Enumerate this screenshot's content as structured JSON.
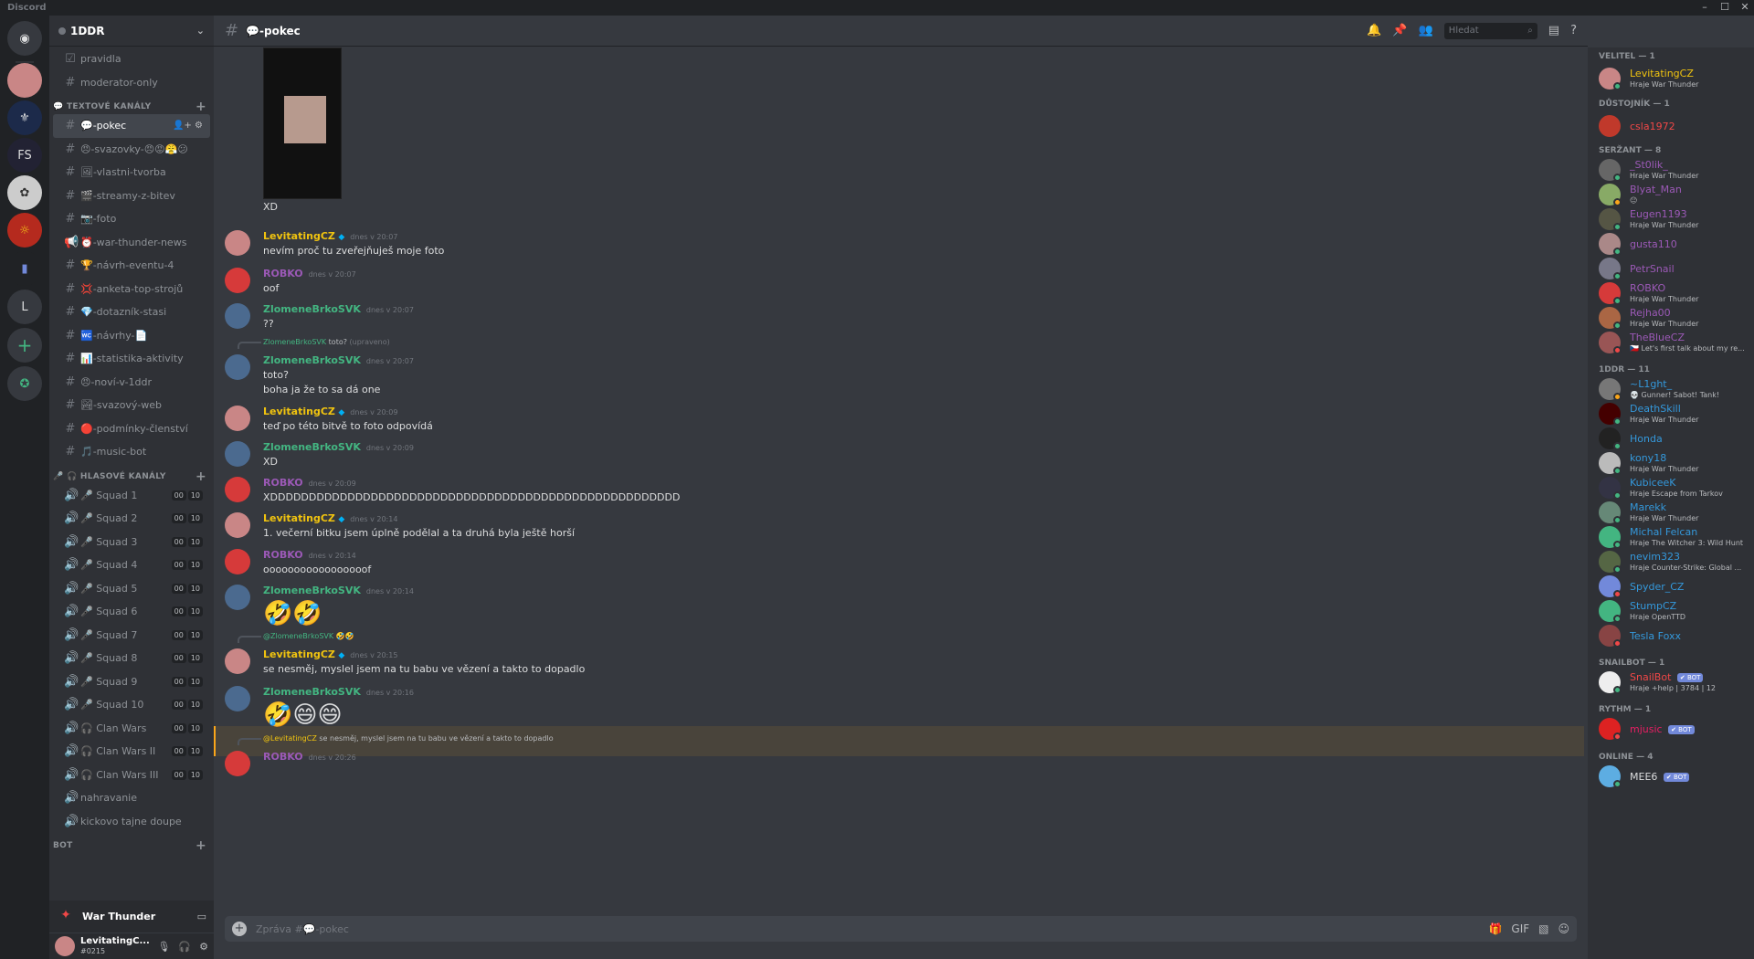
{
  "window": {
    "app_name": "Discord"
  },
  "guild": {
    "name": "1DDR"
  },
  "channels": {
    "top": [
      {
        "icon": "☑",
        "label": "pravidla"
      },
      {
        "icon": "#",
        "label": "moderator-only"
      }
    ],
    "text_category": "💬 TEXTOVÉ KANÁLY",
    "text": [
      "💬-pokec",
      "😠-svazovky-😠😡😤😕",
      "🖼-vlastni-tvorba",
      "🎬-streamy-z-bitev",
      "📷-foto",
      "⏰-war-thunder-news",
      "🏆-návrh-eventu-4",
      "💢-anketa-top-strojů",
      "💎-dotazník-stasi",
      "🚾-návrhy-📄",
      "📊-statistika-aktivity",
      "😠-noví-v-1ddr",
      "🏞-svazový-web",
      "🔴-podmínky-členství",
      "🎵-music-bot"
    ],
    "voice_category": "🎤 🎧 HLASOVÉ KANÁLY",
    "voice": [
      "🎤 Squad 1",
      "🎤 Squad 2",
      "🎤 Squad 3",
      "🎤 Squad 4",
      "🎤 Squad 5",
      "🎤 Squad 6",
      "🎤 Squad 7",
      "🎤 Squad 8",
      "🎤 Squad 9",
      "🎤 Squad 10",
      "🎧 Clan Wars",
      "🎧 Clan Wars II",
      "🎧 Clan Wars III"
    ],
    "extra": [
      "nahravanie",
      "kickovo tajne doupe"
    ],
    "count_left": "00",
    "count_right": "10",
    "bot_category": "BOT"
  },
  "voice_panel": {
    "label": "War Thunder"
  },
  "user_panel": {
    "name": "LevitatingC...",
    "discriminator": "#0215"
  },
  "topbar": {
    "channel": "💬-pokec",
    "search_placeholder": "Hledat"
  },
  "messages": [
    {
      "name": "",
      "time": "",
      "lines": [
        "XD"
      ]
    },
    {
      "name": "LevitatingCZ",
      "time": "dnes v 20:07",
      "lines": [
        "nevím proč tu zveřejňuješ moje foto"
      ]
    },
    {
      "name": "ROBKO",
      "time": "dnes v 20:07",
      "lines": [
        "oof"
      ]
    },
    {
      "name": "ZlomeneBrkoSVK",
      "time": "dnes v 20:07",
      "lines": [
        "??"
      ]
    },
    {
      "reply_name": "ZlomeneBrkoSVK",
      "reply_text": "toto?",
      "reply_tag": "(upraveno)",
      "name": "ZlomeneBrkoSVK",
      "time": "dnes v 20:07",
      "lines": [
        "toto?",
        "boha ja že to sa dá one"
      ]
    },
    {
      "name": "LevitatingCZ",
      "time": "dnes v 20:09",
      "lines": [
        "teď po této bitvě to foto odpovídá"
      ]
    },
    {
      "name": "ZlomeneBrkoSVK",
      "time": "dnes v 20:09",
      "lines": [
        "XD"
      ]
    },
    {
      "name": "ROBKO",
      "time": "dnes v 20:09",
      "lines": [
        "XDDDDDDDDDDDDDDDDDDDDDDDDDDDDDDDDDDDDDDDDDDDDDDDDDDDDD"
      ]
    },
    {
      "name": "LevitatingCZ",
      "time": "dnes v 20:14",
      "lines": [
        "1. večerní bitku jsem úplně podělal a ta druhá byla ještě horší"
      ]
    },
    {
      "name": "ROBKO",
      "time": "dnes v 20:14",
      "lines": [
        "ooooooooooooooooof"
      ]
    },
    {
      "name": "ZlomeneBrkoSVK",
      "time": "dnes v 20:14",
      "lines": [
        "🤣🤣"
      ]
    },
    {
      "reply_name": "@ZlomeneBrkoSVK",
      "reply_text": "🤣🤣",
      "name": "LevitatingCZ",
      "time": "dnes v 20:15",
      "lines": [
        "se nesměj, myslel jsem na tu babu ve vězení a takto to dopadlo"
      ]
    },
    {
      "name": "ZlomeneBrkoSVK",
      "time": "dnes v 20:16",
      "lines": [
        "🤣😄😄"
      ]
    },
    {
      "reply_name": "@LevitatingCZ",
      "reply_text": "se nesměj, myslel jsem na tu babu ve vězení a takto to dopadlo",
      "name": "ROBKO",
      "time": "dnes v 20:26",
      "lines": []
    }
  ],
  "composer": {
    "placeholder": "Zpráva #💬-pokec"
  },
  "members": {
    "categories": [
      "VELITEL — 1",
      "DŮSTOJNÍK — 1",
      "SERŽANT — 8",
      "1DDR — 11",
      "SNAILBOT — 1",
      "RYTHM — 1",
      "ONLINE — 4"
    ],
    "list": [
      {
        "name": "LevitatingCZ",
        "activity": "Hraje War Thunder"
      },
      {
        "name": "csla1972",
        "activity": ""
      },
      {
        "name": "_St0lik_",
        "activity": "Hraje War Thunder"
      },
      {
        "name": "Blyat_Man",
        "activity": "😐"
      },
      {
        "name": "Eugen1193",
        "activity": "Hraje War Thunder"
      },
      {
        "name": "gusta110",
        "activity": ""
      },
      {
        "name": "PetrSnail",
        "activity": ""
      },
      {
        "name": "ROBKO",
        "activity": "Hraje War Thunder"
      },
      {
        "name": "Rejha00",
        "activity": "Hraje War Thunder"
      },
      {
        "name": "TheBlueCZ",
        "activity": "🇨🇿 Let's first talk about my re..."
      },
      {
        "name": "~L1ght_",
        "activity": "💀 Gunner! Sabot! Tank!"
      },
      {
        "name": "DeathSkill",
        "activity": "Hraje War Thunder"
      },
      {
        "name": "Honda",
        "activity": ""
      },
      {
        "name": "kony18",
        "activity": "Hraje War Thunder"
      },
      {
        "name": "KubiceeK",
        "activity": "Hraje Escape from Tarkov"
      },
      {
        "name": "Marekk",
        "activity": "Hraje War Thunder"
      },
      {
        "name": "Michal Felcan",
        "activity": "Hraje The Witcher 3: Wild Hunt"
      },
      {
        "name": "nevim323",
        "activity": "Hraje Counter-Strike: Global ..."
      },
      {
        "name": "Spyder_CZ",
        "activity": ""
      },
      {
        "name": "StumpCZ",
        "activity": "Hraje OpenTTD"
      },
      {
        "name": "Tesla Foxx",
        "activity": ""
      },
      {
        "name": "SnailBot",
        "activity": "Hraje +help | 3784 | 12"
      },
      {
        "name": "mjusic",
        "activity": ""
      },
      {
        "name": "MEE6",
        "activity": ""
      }
    ],
    "bot_label": "✔ BOT"
  },
  "colors": {
    "accent": "#7289da",
    "online": "#43b581",
    "dnd": "#f04747",
    "idle": "#faa61a"
  }
}
